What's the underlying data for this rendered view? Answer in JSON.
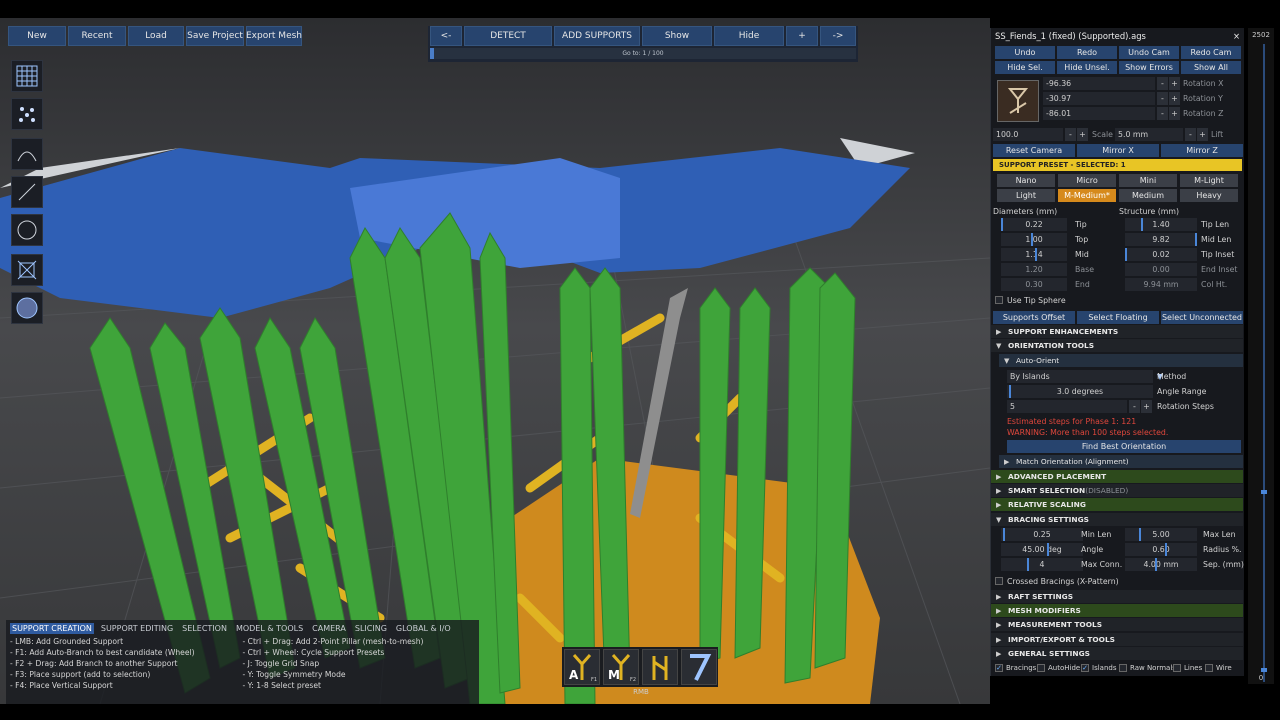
{
  "toolbar": {
    "new": "New",
    "recent": "Recent",
    "load": "Load",
    "save_project": "Save Project",
    "export_mesh": "Export Mesh"
  },
  "nav": {
    "prev": "<-",
    "detect": "DETECT",
    "add_supports": "ADD SUPPORTS",
    "show": "Show",
    "hide": "Hide",
    "plus": "+",
    "next": "->",
    "progress_text": "Go to: 1 / 100",
    "progress_fraction": 0.01
  },
  "left_tools": [
    "grid-tool-icon",
    "points-tool-icon",
    "arc-tool-icon",
    "line-tool-icon",
    "circle-tool-icon",
    "mesh-tool-icon",
    "sphere-tool-icon"
  ],
  "shortcuts": {
    "tabs": [
      "SUPPORT CREATION",
      "SUPPORT EDITING",
      "SELECTION",
      "MODEL & TOOLS",
      "CAMERA",
      "SLICING",
      "GLOBAL & I/O"
    ],
    "left": [
      "- LMB: Add Grounded Support",
      "- F1: Add Auto-Branch to best candidate (Wheel)",
      "- F2 + Drag: Add Branch to another Support",
      "- F3: Place support (add to selection)",
      "- F4: Place Vertical Support"
    ],
    "right": [
      "- Ctrl + Drag: Add 2-Point Pillar (mesh-to-mesh)",
      "- Ctrl + Wheel: Cycle Support Presets",
      "- J: Toggle Grid Snap",
      "- Y: Toggle Symmetry Mode",
      "- Y: 1-8 Select preset"
    ]
  },
  "bottom": {
    "icon1": "A",
    "icon1_sub": "F1",
    "icon2": "M",
    "icon2_sub": "F2",
    "icon3": "Y",
    "icon4": "7",
    "rmb": "RMB"
  },
  "panel": {
    "title": "SS_Fiends_1 (fixed) (Supported).ags",
    "close": "×",
    "undo": "Undo",
    "redo": "Redo",
    "undo_cam": "Undo Cam",
    "redo_cam": "Redo Cam",
    "hide_sel": "Hide Sel.",
    "hide_unsel": "Hide Unsel.",
    "show_errors": "Show Errors",
    "show_all": "Show All",
    "rot_x": "-96.36",
    "rot_x_label": "Rotation X",
    "rot_y": "-30.97",
    "rot_y_label": "Rotation Y",
    "rot_z": "-86.01",
    "rot_z_label": "Rotation Z",
    "scale_pct": "100.0",
    "scale_label": "Scale",
    "scale_mm": "5.0 mm",
    "lift_label": "Lift",
    "reset_camera": "Reset Camera",
    "mirror_x": "Mirror X",
    "mirror_z": "Mirror Z",
    "preset_header": "SUPPORT PRESET - SELECTED: 1",
    "presets": [
      "Nano",
      "Micro",
      "Mini",
      "M-Light",
      "Light",
      "M-Medium*",
      "Medium",
      "Heavy"
    ],
    "diam_header": "Diameters (mm)",
    "struct_header": "Structure (mm)",
    "tip": "0.22",
    "tip_label": "Tip",
    "tip_len": "1.40",
    "tip_len_label": "Tip Len",
    "top": "1.00",
    "top_label": "Top",
    "mid_len": "9.82",
    "mid_len_label": "Mid Len",
    "mid": "1.14",
    "mid_label": "Mid",
    "tip_inset": "0.02",
    "tip_inset_label": "Tip Inset",
    "base": "1.20",
    "base_label": "Base",
    "end_inset": "0.00",
    "end_inset_label": "End Inset",
    "end": "0.30",
    "end_label": "End",
    "col_ht": "9.94 mm",
    "col_ht_label": "Col Ht.",
    "use_tip_sphere": "Use Tip Sphere",
    "supports_offset": "Supports Offset",
    "select_floating": "Select Floating",
    "select_unconnected": "Select Unconnected",
    "support_enh": "SUPPORT ENHANCEMENTS",
    "orientation_tools": "ORIENTATION TOOLS",
    "auto_orient": "Auto-Orient",
    "method_value": "By Islands",
    "method_label": "Method",
    "angle_range": "3.0 degrees",
    "angle_range_label": "Angle Range",
    "rotation_steps": "5",
    "rotation_steps_label": "Rotation Steps",
    "est_steps": "Estimated steps for Phase 1: 121",
    "warning": "WARNING: More than 100 steps selected.",
    "find_best": "Find Best Orientation",
    "match_orient": "Match Orientation (Alignment)",
    "adv_placement": "ADVANCED PLACEMENT",
    "smart_sel": "SMART SELECTION",
    "smart_sel_tag": "(DISABLED)",
    "rel_scaling": "RELATIVE SCALING",
    "bracing": "BRACING SETTINGS",
    "min_len": "0.25",
    "min_len_label": "Min Len",
    "max_len": "5.00",
    "max_len_label": "Max Len",
    "angle": "45.00 deg",
    "angle_label": "Angle",
    "radius": "0.60",
    "radius_label": "Radius %.",
    "max_conn": "4",
    "max_conn_label": "Max Conn.",
    "sep": "4.00 mm",
    "sep_label": "Sep. (mm)",
    "crossed": "Crossed Bracings (X-Pattern)",
    "raft": "RAFT SETTINGS",
    "mesh_mod": "MESH MODIFIERS",
    "measurement": "MEASUREMENT TOOLS",
    "import_export": "IMPORT/EXPORT & TOOLS",
    "general": "GENERAL SETTINGS",
    "toggles": [
      "Bracings",
      "AutoHide",
      "Islands",
      "Raw Normals",
      "Lines",
      "Wire"
    ]
  },
  "scroll": {
    "top": "2502",
    "bottom": "0"
  },
  "colors": {
    "accent": "#27446e",
    "preset_bar": "#e8c525",
    "selected_preset": "#d68a1c",
    "supports": "#3fa43a",
    "braces": "#e0b322",
    "model": "#2f5fb5",
    "raft": "#cf8a1e"
  }
}
